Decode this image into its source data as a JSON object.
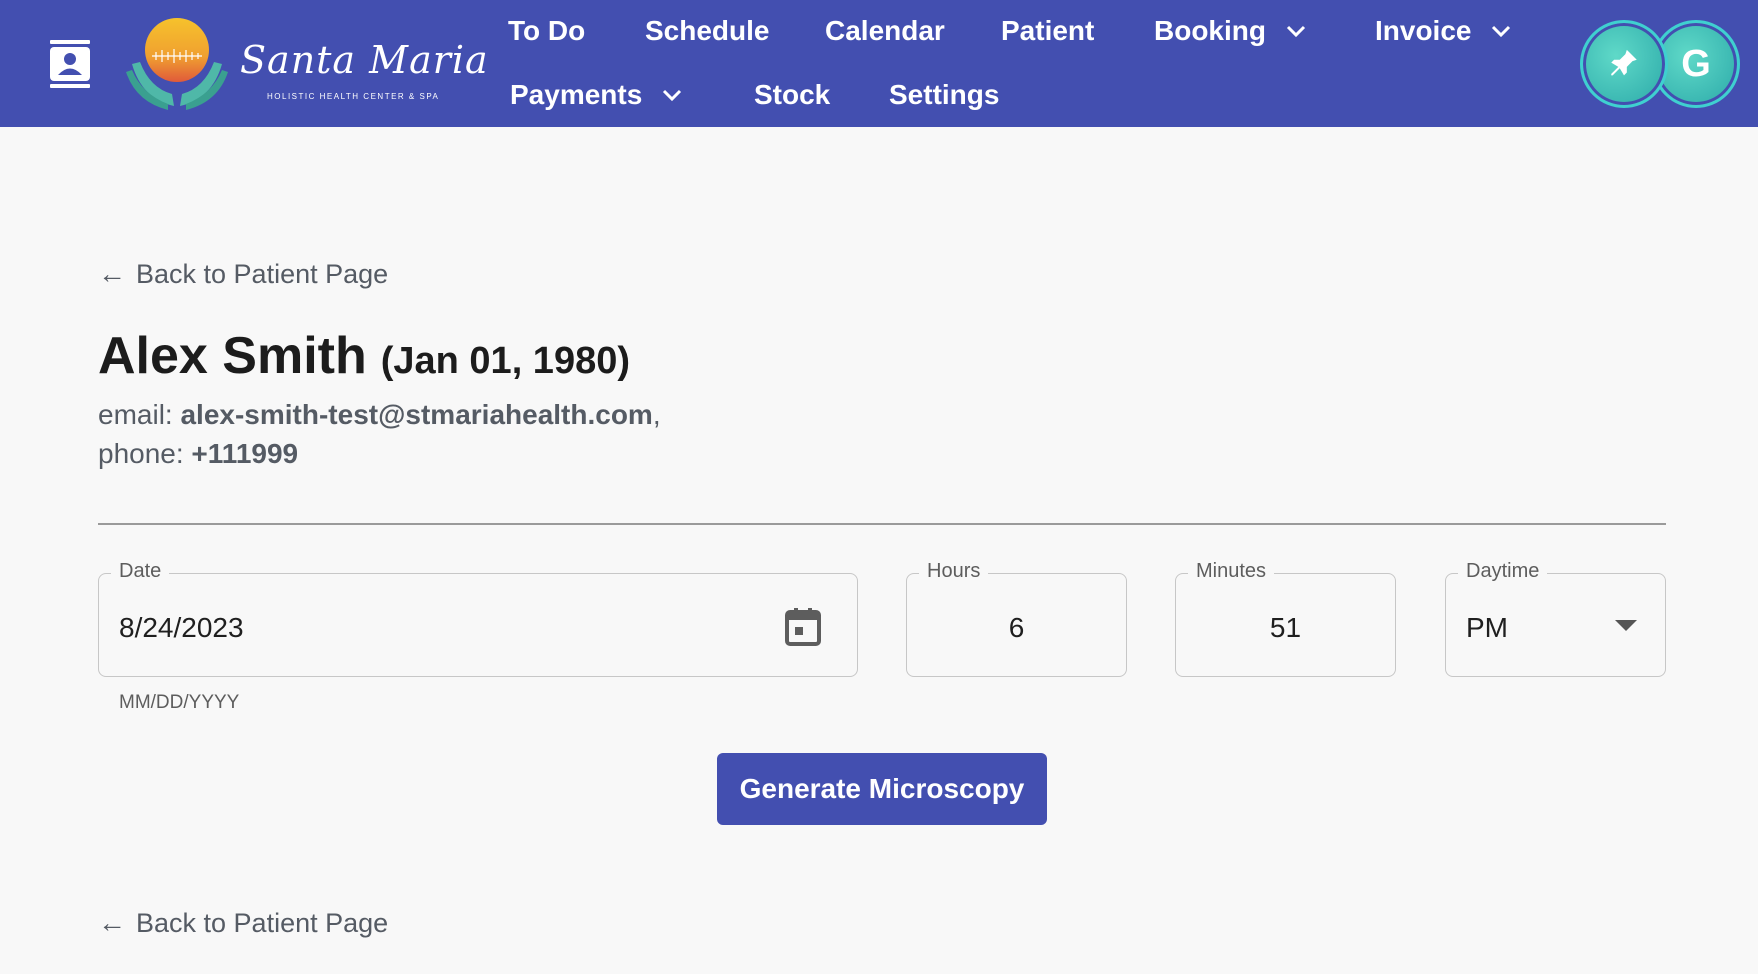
{
  "header": {
    "contact_icon": "contact-card-icon",
    "logo": {
      "script_text": "Santa Maria",
      "subtitle": "HOLISTIC HEALTH CENTER & SPA"
    },
    "nav": {
      "todo": "To Do",
      "schedule": "Schedule",
      "calendar": "Calendar",
      "patient": "Patient",
      "booking": "Booking",
      "invoice": "Invoice",
      "payments": "Payments",
      "stock": "Stock",
      "settings": "Settings"
    },
    "avatar_pin_icon": "pin-icon",
    "avatar_letter": "G",
    "colors": {
      "bar": "#434fb0",
      "avatar": "#2aa8a8",
      "avatar_ring": "#3fd0d0"
    }
  },
  "back_link_top": "Back to Patient Page",
  "back_link_bottom": "Back to Patient Page",
  "patient": {
    "name": "Alex Smith",
    "dob": "(Jan 01, 1980)",
    "email_label": "email:",
    "email": "alex-smith-test@stmariahealth.com",
    "email_suffix": ",",
    "phone_label": "phone:",
    "phone": "+111999"
  },
  "form": {
    "date": {
      "label": "Date",
      "value": "8/24/2023",
      "helper": "MM/DD/YYYY"
    },
    "hours": {
      "label": "Hours",
      "value": "6"
    },
    "minutes": {
      "label": "Minutes",
      "value": "51"
    },
    "daytime": {
      "label": "Daytime",
      "value": "PM"
    }
  },
  "actions": {
    "generate": "Generate Microscopy"
  }
}
